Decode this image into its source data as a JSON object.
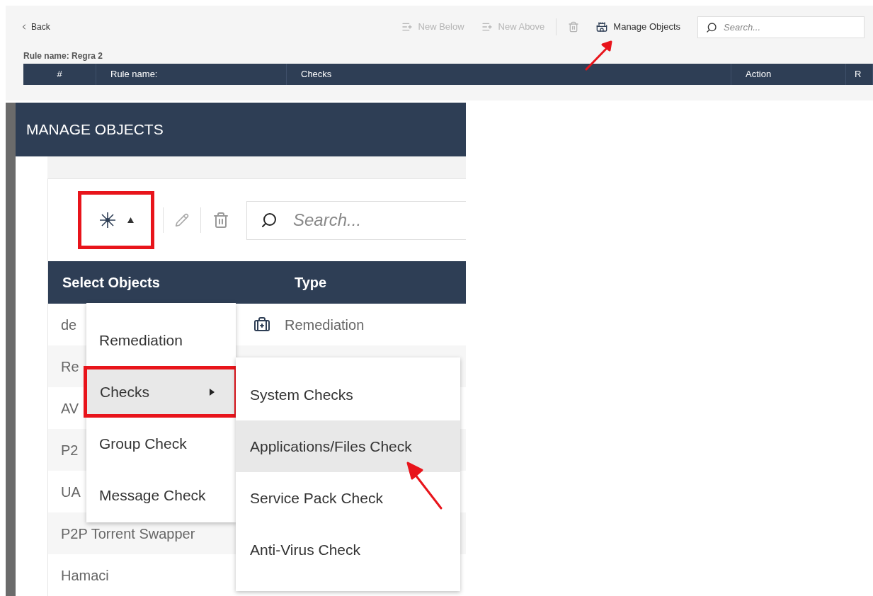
{
  "toolbar": {
    "back": "Back",
    "buttons": [
      {
        "kind": "new-below",
        "label": "New Below",
        "disabled": true
      },
      {
        "kind": "new-above",
        "label": "New Above",
        "disabled": true
      },
      {
        "kind": "delete",
        "disabled": true
      },
      {
        "kind": "manage",
        "label": "Manage Objects",
        "disabled": false
      }
    ],
    "search": {
      "placeholder": "Search..."
    }
  },
  "rule_title": "Rule name: Regra 2",
  "rule_table": {
    "columns": [
      "#",
      "Rule name:",
      "Checks",
      "Action",
      "R"
    ]
  },
  "dialog": {
    "title": "MANAGE OBJECTS",
    "toolbar": {
      "add_outlined": true,
      "search": {
        "placeholder": "Search..."
      }
    },
    "table": {
      "columns": [
        "Select Objects",
        "Type"
      ],
      "rows": [
        {
          "name": "de",
          "type": "Remediation"
        },
        {
          "name": "Re"
        },
        {
          "name": "AV"
        },
        {
          "name": "P2"
        },
        {
          "name": "UA"
        },
        {
          "name": "P2P Torrent Swapper"
        },
        {
          "name": "Hamaci"
        }
      ]
    },
    "menu": [
      {
        "label": "Remediation",
        "selected": false,
        "outlined": false,
        "submenu": false
      },
      {
        "label": "Checks",
        "selected": true,
        "outlined": true,
        "submenu": true
      },
      {
        "label": "Group Check",
        "selected": false,
        "outlined": false,
        "submenu": false
      },
      {
        "label": "Message Check",
        "selected": false,
        "outlined": false,
        "submenu": false
      }
    ],
    "submenu": [
      {
        "label": "System Checks",
        "selected": false
      },
      {
        "label": "Applications/Files Check",
        "selected": true
      },
      {
        "label": "Service Pack Check",
        "selected": false
      },
      {
        "label": "Anti-Virus Check",
        "selected": false
      }
    ]
  }
}
